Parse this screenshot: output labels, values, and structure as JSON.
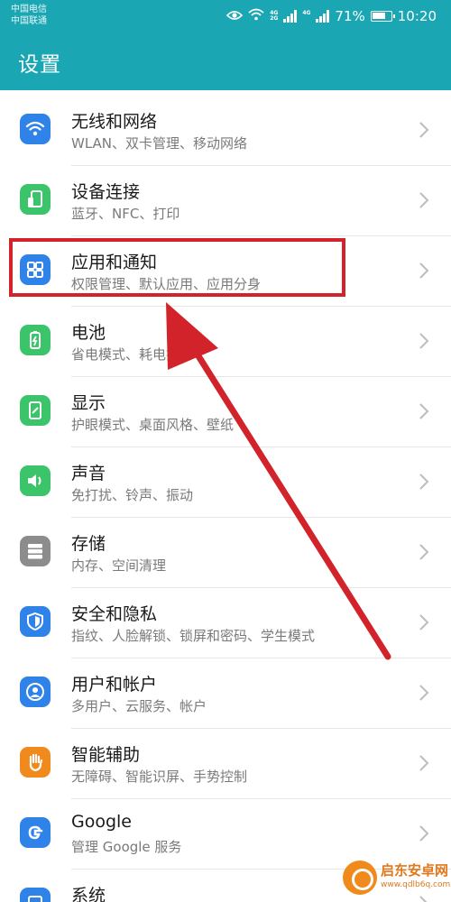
{
  "status_bar": {
    "carrier_1": "中国电信",
    "carrier_2": "中国联通",
    "battery": "71%",
    "time": "10:20"
  },
  "header": {
    "title": "设置"
  },
  "settings": [
    {
      "title": "无线和网络",
      "subtitle": "WLAN、双卡管理、移动网络",
      "icon": "wifi-icon",
      "color": "#2f83e8"
    },
    {
      "title": "设备连接",
      "subtitle": "蓝牙、NFC、打印",
      "icon": "device-connection-icon",
      "color": "#3cc46b"
    },
    {
      "title": "应用和通知",
      "subtitle": "权限管理、默认应用、应用分身",
      "icon": "apps-grid-icon",
      "color": "#2f83e8"
    },
    {
      "title": "电池",
      "subtitle": "省电模式、耗电排行",
      "icon": "battery-icon",
      "color": "#3cc46b"
    },
    {
      "title": "显示",
      "subtitle": "护眼模式、桌面风格、壁纸",
      "icon": "display-icon",
      "color": "#3cc46b"
    },
    {
      "title": "声音",
      "subtitle": "免打扰、铃声、振动",
      "icon": "speaker-icon",
      "color": "#3cc46b"
    },
    {
      "title": "存储",
      "subtitle": "内存、空间清理",
      "icon": "storage-icon",
      "color": "#8c8c8c"
    },
    {
      "title": "安全和隐私",
      "subtitle": "指纹、人脸解锁、锁屏和密码、学生模式",
      "icon": "shield-icon",
      "color": "#2f83e8"
    },
    {
      "title": "用户和帐户",
      "subtitle": "多用户、云服务、帐户",
      "icon": "user-icon",
      "color": "#2f83e8"
    },
    {
      "title": "智能辅助",
      "subtitle": "无障碍、智能识屏、手势控制",
      "icon": "hand-icon",
      "color": "#f08a1c"
    },
    {
      "title": "Google",
      "subtitle": "管理 Google 服务",
      "icon": "google-icon",
      "color": "#2f83e8"
    },
    {
      "title": "系统",
      "subtitle": "",
      "icon": "system-icon",
      "color": "#2f83e8"
    }
  ],
  "annotation": {
    "highlighted_item": "应用和通知",
    "color": "#d2232a"
  },
  "watermark": {
    "name": "启东安卓网",
    "url": "www.qdlb6q.com"
  }
}
